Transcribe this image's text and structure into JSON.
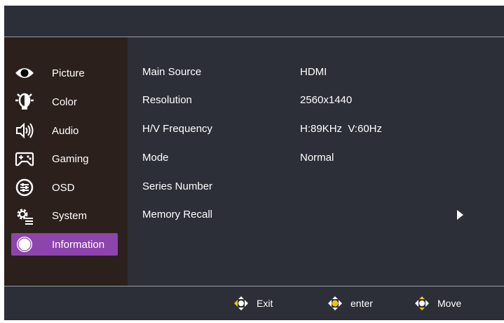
{
  "sidebar": {
    "items": [
      {
        "label": "Picture",
        "icon": "eye-icon"
      },
      {
        "label": "Color",
        "icon": "color-bulb-icon"
      },
      {
        "label": "Audio",
        "icon": "speaker-icon"
      },
      {
        "label": "Gaming",
        "icon": "gamepad-icon"
      },
      {
        "label": "OSD",
        "icon": "osd-sliders-icon"
      },
      {
        "label": "System",
        "icon": "gear-list-icon"
      },
      {
        "label": "Information",
        "icon": "circle-icon",
        "active": true
      }
    ]
  },
  "info": {
    "rows": [
      {
        "label": "Main Source",
        "value": "HDMI"
      },
      {
        "label": "Resolution",
        "value": "2560x1440"
      },
      {
        "label": "H/V Frequency",
        "value": "H:89KHz  V:60Hz"
      },
      {
        "label": "Mode",
        "value": "Normal"
      },
      {
        "label": "Series Number",
        "value": ""
      },
      {
        "label": "Memory Recall",
        "value": ""
      }
    ]
  },
  "footer": {
    "exit_label": "Exit",
    "enter_label": "enter",
    "move_label": "Move"
  },
  "colors": {
    "panel": "#2c2e38",
    "sidebar": "#2c201c",
    "active": "#8e44ad",
    "joystick_accent": "#f2c500"
  }
}
